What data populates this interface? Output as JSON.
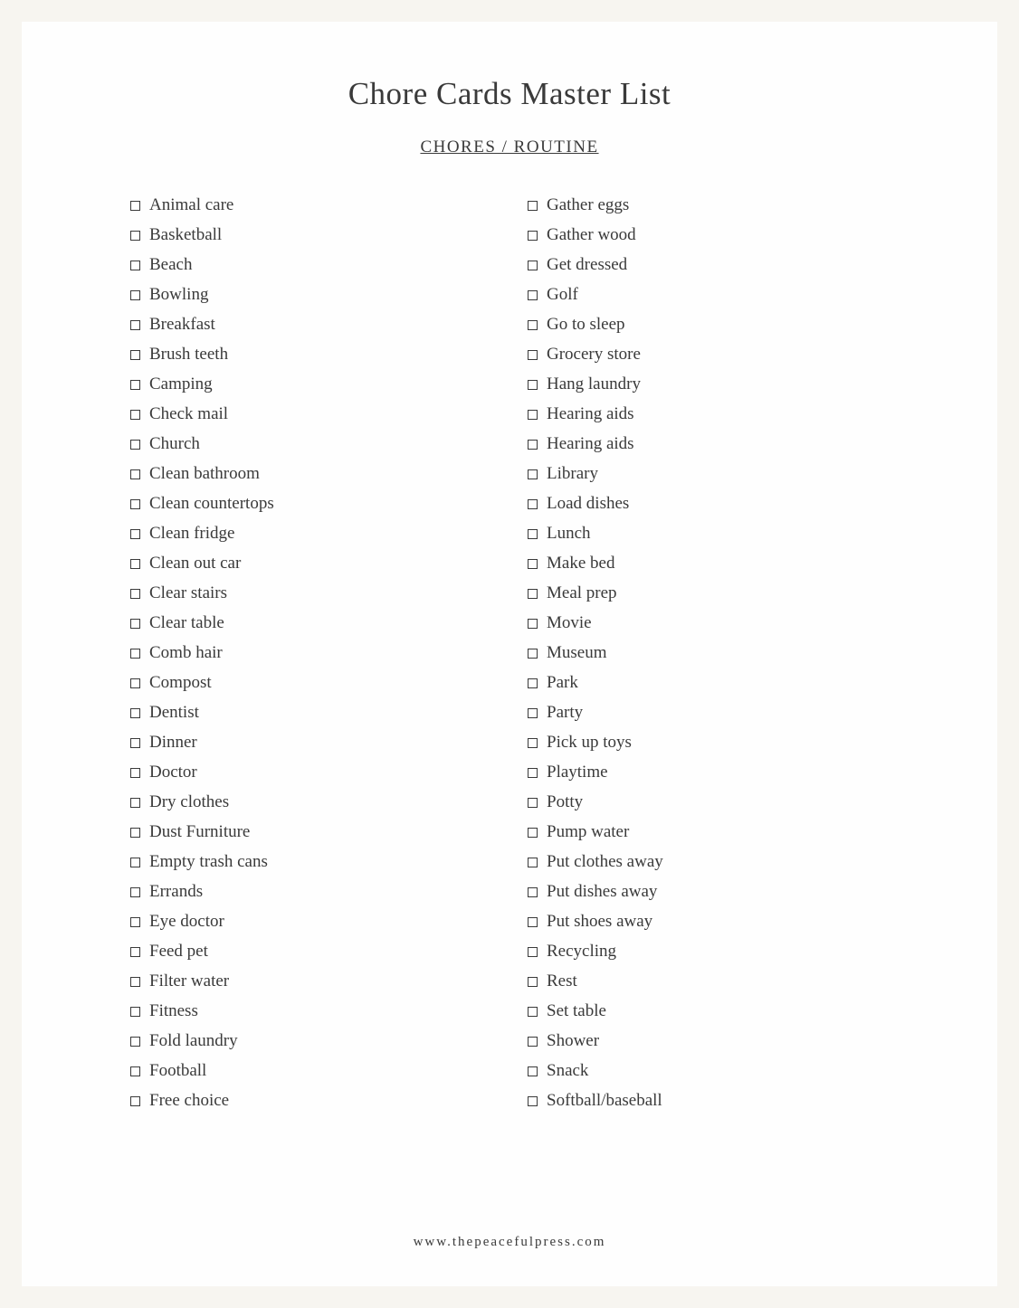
{
  "title": "Chore Cards Master List",
  "subtitle": "CHORES / ROUTINE",
  "footer": "www.thepeacefulpress.com",
  "columns": [
    {
      "items": [
        "Animal care",
        "Basketball",
        "Beach",
        "Bowling",
        "Breakfast",
        "Brush teeth",
        "Camping",
        "Check mail",
        "Church",
        "Clean bathroom",
        "Clean countertops",
        "Clean fridge",
        "Clean out car",
        "Clear stairs",
        "Clear table",
        "Comb hair",
        "Compost",
        "Dentist",
        "Dinner",
        "Doctor",
        "Dry clothes",
        "Dust Furniture",
        "Empty trash cans",
        "Errands",
        "Eye doctor",
        "Feed pet",
        "Filter water",
        "Fitness",
        "Fold laundry",
        "Football",
        "Free choice"
      ]
    },
    {
      "items": [
        "Gather eggs",
        "Gather wood",
        "Get dressed",
        "Golf",
        "Go to sleep",
        "Grocery store",
        "Hang laundry",
        "Hearing aids",
        "Hearing aids",
        "Library",
        "Load dishes",
        "Lunch",
        "Make bed",
        "Meal prep",
        "Movie",
        "Museum",
        "Park",
        "Party",
        "Pick up toys",
        "Playtime",
        "Potty",
        "Pump water",
        "Put clothes away",
        "Put dishes away",
        "Put shoes away",
        "Recycling",
        "Rest",
        "Set table",
        "Shower",
        "Snack",
        "Softball/baseball"
      ]
    }
  ]
}
